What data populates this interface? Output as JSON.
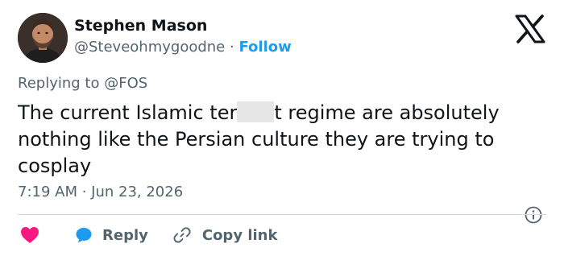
{
  "author": {
    "name": "Stephen Mason",
    "handle": "@Steveohmygoodne",
    "separator": "·",
    "follow_label": "Follow"
  },
  "reply_context": {
    "prefix": "Replying to",
    "mention": "@FOS"
  },
  "tweet": {
    "text_before_redaction": "The current Islamic ter",
    "text_after_redaction": "t regime are absolutely nothing like the Persian culture they are trying to cosplay"
  },
  "timestamp": "7:19 AM · Jun 23, 2026",
  "actions": {
    "reply_label": "Reply",
    "copy_link_label": "Copy link"
  },
  "colors": {
    "accent": "#1d9bf0",
    "like": "#f91880",
    "secondary_text": "#536471",
    "primary_text": "#0f1419"
  },
  "icons": [
    "x-logo-icon",
    "info-icon",
    "heart-icon",
    "reply-bubble-icon",
    "link-icon"
  ]
}
